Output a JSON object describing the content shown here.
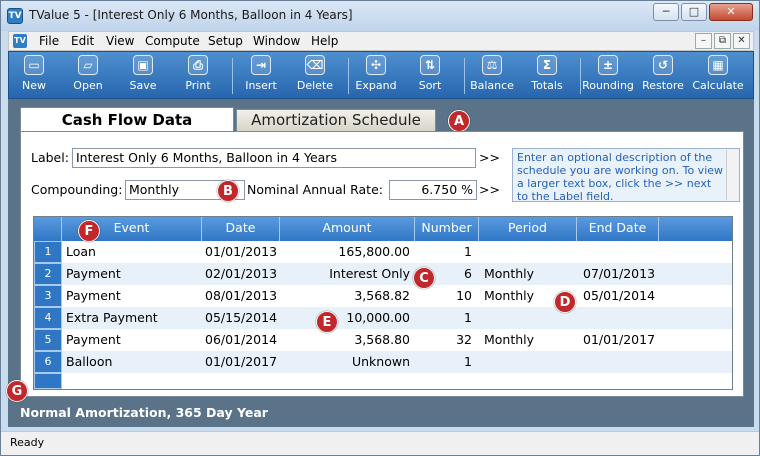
{
  "window": {
    "app_icon": "TV",
    "title": "TValue 5 - [Interest Only 6 Months, Balloon in 4 Years]",
    "min": "─",
    "max": "□",
    "close": "✕"
  },
  "menubar": {
    "items": [
      "File",
      "Edit",
      "View",
      "Compute",
      "Setup",
      "Window",
      "Help"
    ],
    "mdi_min": "–",
    "mdi_restore": "⧉",
    "mdi_close": "✕"
  },
  "toolbar": {
    "buttons": [
      {
        "label": "New",
        "icon": "new-document-icon",
        "glyph": "▭"
      },
      {
        "label": "Open",
        "icon": "open-folder-icon",
        "glyph": "▱"
      },
      {
        "label": "Save",
        "icon": "save-disk-icon",
        "glyph": "▣"
      },
      {
        "label": "Print",
        "icon": "printer-icon",
        "glyph": "⎙"
      },
      {
        "label": "Insert",
        "icon": "insert-row-icon",
        "glyph": "⇥"
      },
      {
        "label": "Delete",
        "icon": "delete-row-icon",
        "glyph": "⌫"
      },
      {
        "label": "Expand",
        "icon": "expand-icon",
        "glyph": "✣"
      },
      {
        "label": "Sort",
        "icon": "sort-icon",
        "glyph": "⇅"
      },
      {
        "label": "Balance",
        "icon": "balance-scale-icon",
        "glyph": "⚖"
      },
      {
        "label": "Totals",
        "icon": "sigma-totals-icon",
        "glyph": "Σ"
      },
      {
        "label": "Rounding",
        "icon": "rounding-icon",
        "glyph": "±"
      },
      {
        "label": "Restore",
        "icon": "restore-icon",
        "glyph": "↺"
      },
      {
        "label": "Calculate",
        "icon": "calculator-icon",
        "glyph": "▦"
      }
    ]
  },
  "tabs": {
    "cash_flow": "Cash Flow Data",
    "amortization": "Amortization Schedule"
  },
  "form": {
    "label_caption": "Label:",
    "label_value": "Interest Only 6 Months, Balloon in 4 Years",
    "label_arrows": ">>",
    "compounding_caption": "Compounding:",
    "compounding_value": "Monthly",
    "rate_caption": "Nominal Annual Rate:",
    "rate_value": "6.750 %",
    "rate_arrows": ">>",
    "description": "Enter an optional description of the schedule you are working on.  To view a larger text box, click the >> next to the Label field."
  },
  "grid": {
    "headers": [
      "Event",
      "Date",
      "Amount",
      "Number",
      "Period",
      "End Date"
    ],
    "rows": [
      {
        "num": "1",
        "event": "Loan",
        "date": "01/01/2013",
        "amount": "165,800.00",
        "number": "1",
        "period": "",
        "end": ""
      },
      {
        "num": "2",
        "event": "Payment",
        "date": "02/01/2013",
        "amount": "Interest Only",
        "number": "6",
        "period": "Monthly",
        "end": "07/01/2013"
      },
      {
        "num": "3",
        "event": "Payment",
        "date": "08/01/2013",
        "amount": "3,568.82",
        "number": "10",
        "period": "Monthly",
        "end": "05/01/2014"
      },
      {
        "num": "4",
        "event": "Extra Payment",
        "date": "05/15/2014",
        "amount": "10,000.00",
        "number": "1",
        "period": "",
        "end": ""
      },
      {
        "num": "5",
        "event": "Payment",
        "date": "06/01/2014",
        "amount": "3,568.80",
        "number": "32",
        "period": "Monthly",
        "end": "01/01/2017"
      },
      {
        "num": "6",
        "event": "Balloon",
        "date": "01/01/2017",
        "amount": "Unknown",
        "number": "1",
        "period": "",
        "end": ""
      }
    ]
  },
  "callouts": [
    "A",
    "B",
    "C",
    "D",
    "E",
    "F",
    "G"
  ],
  "info_line": "Normal Amortization, 365 Day Year",
  "status": "Ready"
}
